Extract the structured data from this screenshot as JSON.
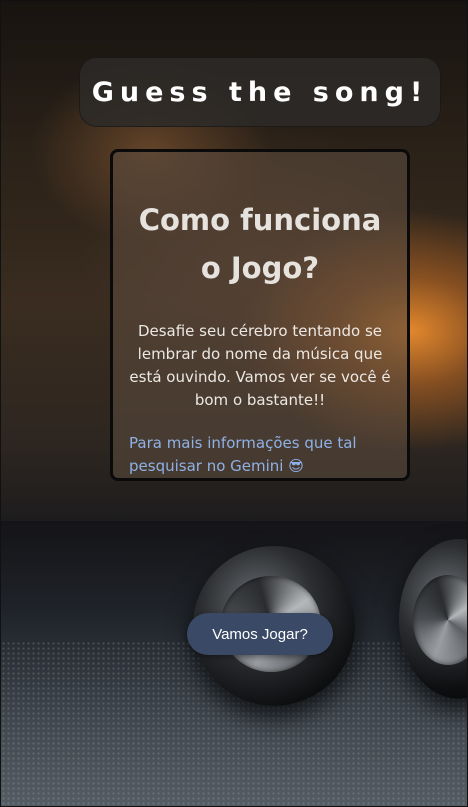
{
  "header": {
    "title": "Guess the song!"
  },
  "card": {
    "heading": "Como funciona o Jogo?",
    "description": "Desafie seu cérebro tentando se lembrar do nome da música que está ouvindo. Vamos ver se você é bom o bastante!!",
    "more_info": "Para mais informações que tal pesquisar no Gemini",
    "emoji": "😎"
  },
  "actions": {
    "play_label": "Vamos Jogar?"
  },
  "colors": {
    "title_pill_bg": "#2d2a28",
    "link_text": "#8fb1e6",
    "button_bg": "#3a4a66"
  }
}
